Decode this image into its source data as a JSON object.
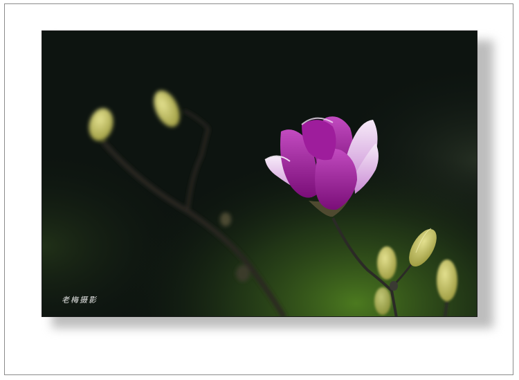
{
  "photo": {
    "subject": "magnolia-blossom",
    "colors": {
      "background_dark": "#0d1410",
      "background_green": "#3f6b1f",
      "petal_magenta": "#a01a9c",
      "petal_light": "#e9c8ef",
      "bud_yellow_green": "#c9c86a",
      "branch": "#2b2a26"
    }
  },
  "watermark": {
    "signature": "老梅摄影"
  }
}
